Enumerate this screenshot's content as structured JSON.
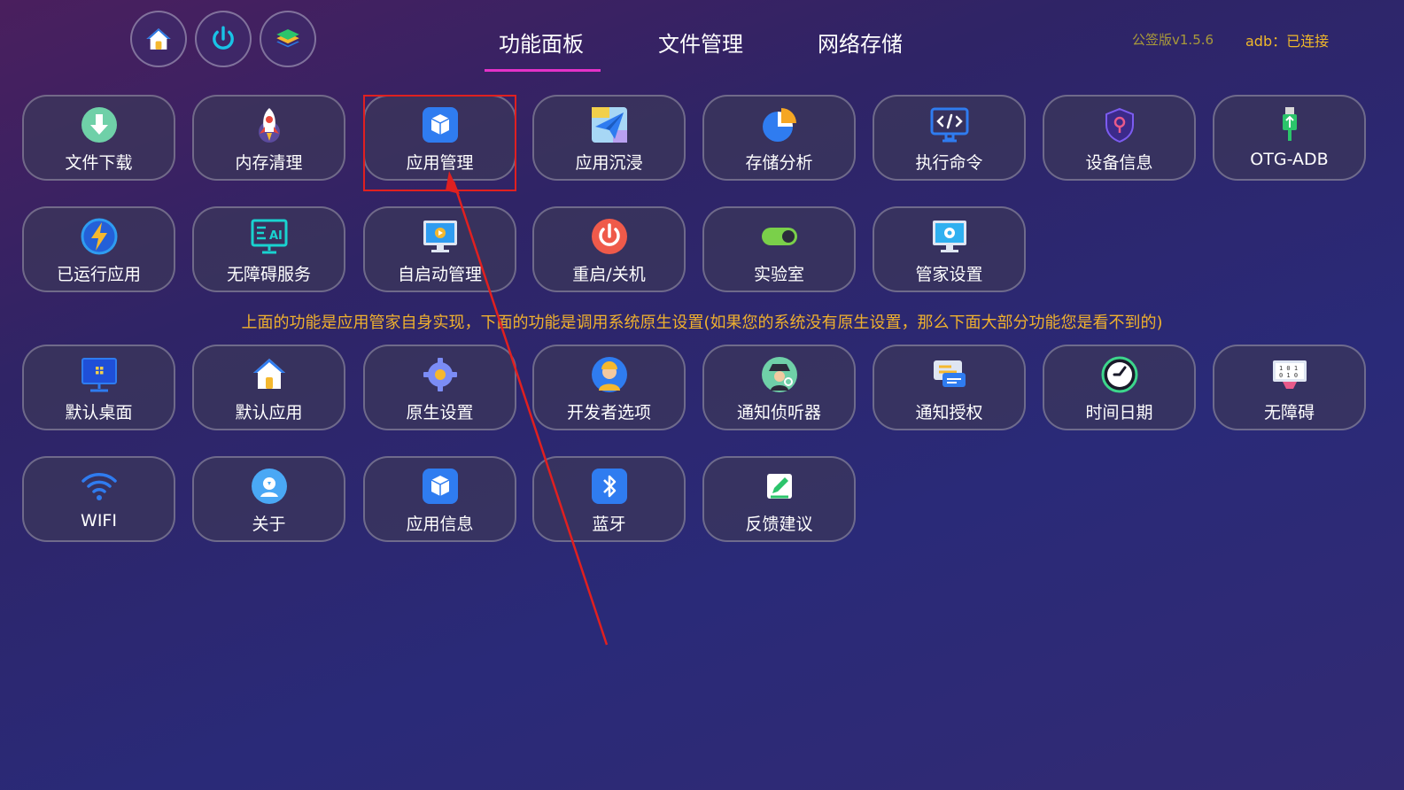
{
  "header": {
    "top_icons": [
      {
        "name": "home-icon"
      },
      {
        "name": "power-icon"
      },
      {
        "name": "layers-icon"
      }
    ],
    "tabs": [
      {
        "label": "功能面板",
        "active": true
      },
      {
        "label": "文件管理",
        "active": false
      },
      {
        "label": "网络存储",
        "active": false
      }
    ],
    "version": "公签版v1.5.6",
    "adb_status": "adb：已连接"
  },
  "notice": "上面的功能是应用管家自身实现，下面的功能是调用系统原生设置(如果您的系统没有原生设置，那么下面大部分功能您是看不到的)",
  "tiles": [
    {
      "label": "文件下载",
      "icon": "download-icon"
    },
    {
      "label": "内存清理",
      "icon": "rocket-icon"
    },
    {
      "label": "应用管理",
      "icon": "cube-icon"
    },
    {
      "label": "应用沉浸",
      "icon": "paper-plane-icon"
    },
    {
      "label": "存储分析",
      "icon": "pie-chart-icon"
    },
    {
      "label": "执行命令",
      "icon": "code-monitor-icon"
    },
    {
      "label": "设备信息",
      "icon": "shield-location-icon"
    },
    {
      "label": "OTG-ADB",
      "icon": "usb-icon"
    },
    {
      "label": "已运行应用",
      "icon": "lightning-icon"
    },
    {
      "label": "无障碍服务",
      "icon": "ai-monitor-icon"
    },
    {
      "label": "自启动管理",
      "icon": "autostart-monitor-icon"
    },
    {
      "label": "重启/关机",
      "icon": "power-button-icon"
    },
    {
      "label": "实验室",
      "icon": "toggle-icon"
    },
    {
      "label": "管家设置",
      "icon": "settings-monitor-icon"
    },
    {
      "label": "默认桌面",
      "icon": "desktop-icon"
    },
    {
      "label": "默认应用",
      "icon": "house-icon"
    },
    {
      "label": "原生设置",
      "icon": "gear-icon"
    },
    {
      "label": "开发者选项",
      "icon": "worker-icon"
    },
    {
      "label": "通知侦听器",
      "icon": "spy-icon"
    },
    {
      "label": "通知授权",
      "icon": "message-icon"
    },
    {
      "label": "时间日期",
      "icon": "clock-icon"
    },
    {
      "label": "无障碍",
      "icon": "binary-monitor-icon"
    },
    {
      "label": "WIFI",
      "icon": "wifi-icon"
    },
    {
      "label": "关于",
      "icon": "about-icon"
    },
    {
      "label": "应用信息",
      "icon": "cube-info-icon"
    },
    {
      "label": "蓝牙",
      "icon": "bluetooth-icon"
    },
    {
      "label": "反馈建议",
      "icon": "feedback-icon"
    }
  ],
  "annotation": {
    "highlighted_tile": "应用管理",
    "color": "#e02020"
  }
}
